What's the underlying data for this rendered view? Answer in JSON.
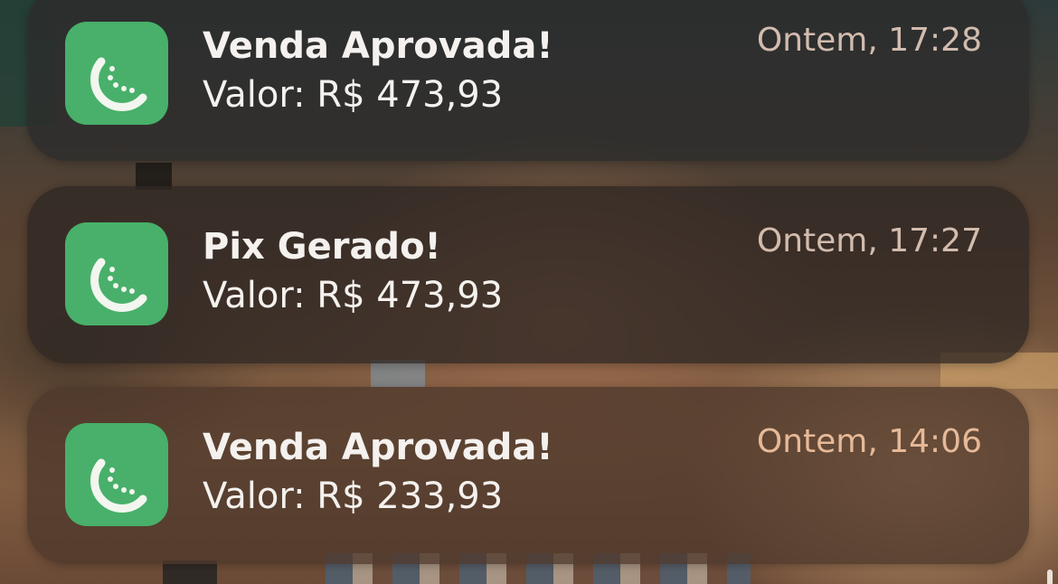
{
  "notifications": [
    {
      "app_icon": "melon-slice-icon",
      "title": "Venda Aprovada!",
      "body": "Valor: R$ 473,93",
      "time": "Ontem, 17:28"
    },
    {
      "app_icon": "melon-slice-icon",
      "title": "Pix Gerado!",
      "body": "Valor: R$ 473,93",
      "time": "Ontem, 17:27"
    },
    {
      "app_icon": "melon-slice-icon",
      "title": "Venda Aprovada!",
      "body": "Valor: R$ 233,93",
      "time": "Ontem, 14:06"
    }
  ],
  "colors": {
    "app_icon_background": "#48b06a",
    "text": "#f4f1ee",
    "time_text": "#d2bcae"
  }
}
